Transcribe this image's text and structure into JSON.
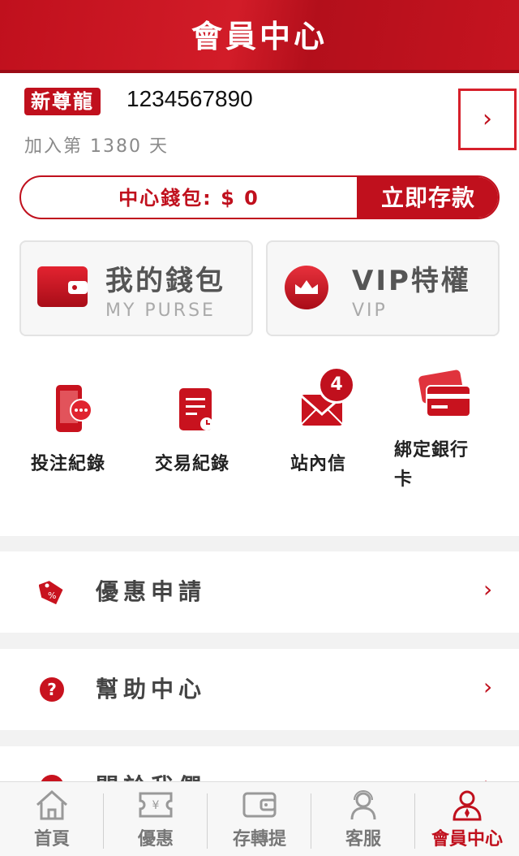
{
  "header": {
    "title": "會員中心"
  },
  "profile": {
    "level_badge": "新尊龍",
    "user_id": "1234567890",
    "join_days": "加入第 1380 天",
    "arrow": "›"
  },
  "wallet": {
    "balance_label": "中心錢包: $ 0",
    "deposit_label": "立即存款"
  },
  "cards": [
    {
      "title": "我的錢包",
      "subtitle": "MY PURSE",
      "icon": "wallet-icon"
    },
    {
      "title": "VIP特權",
      "subtitle": "VIP",
      "icon": "crown-icon"
    }
  ],
  "shortcuts": [
    {
      "label": "投注紀錄",
      "icon": "phone-chat-icon"
    },
    {
      "label": "交易紀錄",
      "icon": "document-clock-icon"
    },
    {
      "label": "站內信",
      "icon": "mail-icon",
      "badge": "4"
    },
    {
      "label": "綁定銀行卡",
      "icon": "bank-card-icon"
    }
  ],
  "menu": [
    {
      "label": "優惠申請",
      "icon": "discount-tag-icon",
      "chevron": "›"
    },
    {
      "label": "幫助中心",
      "icon": "help-icon",
      "chevron": "›"
    },
    {
      "label": "關於我們",
      "icon": "info-icon",
      "chevron": "›"
    }
  ],
  "tabbar": [
    {
      "label": "首頁",
      "icon": "home-icon"
    },
    {
      "label": "優惠",
      "icon": "coupon-icon"
    },
    {
      "label": "存轉提",
      "icon": "wallet-outline-icon"
    },
    {
      "label": "客服",
      "icon": "headset-icon"
    },
    {
      "label": "會員中心",
      "icon": "member-icon",
      "active": true
    }
  ],
  "colors": {
    "brand_red": "#c0101d",
    "text_gray": "#8a8a8a",
    "background": "#f2f2f2"
  }
}
